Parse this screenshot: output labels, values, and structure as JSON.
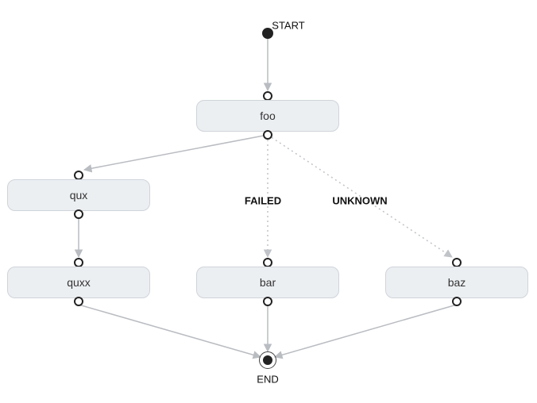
{
  "labels": {
    "start": "START",
    "end": "END",
    "failed": "FAILED",
    "unknown": "UNKNOWN"
  },
  "nodes": {
    "foo": "foo",
    "qux": "qux",
    "quxx": "quxx",
    "bar": "bar",
    "baz": "baz"
  },
  "colors": {
    "node_bg": "#eceff2",
    "node_border": "#cfd4da",
    "edge": "#b9bcc1",
    "edge_dashed": "#c0c3c8"
  }
}
